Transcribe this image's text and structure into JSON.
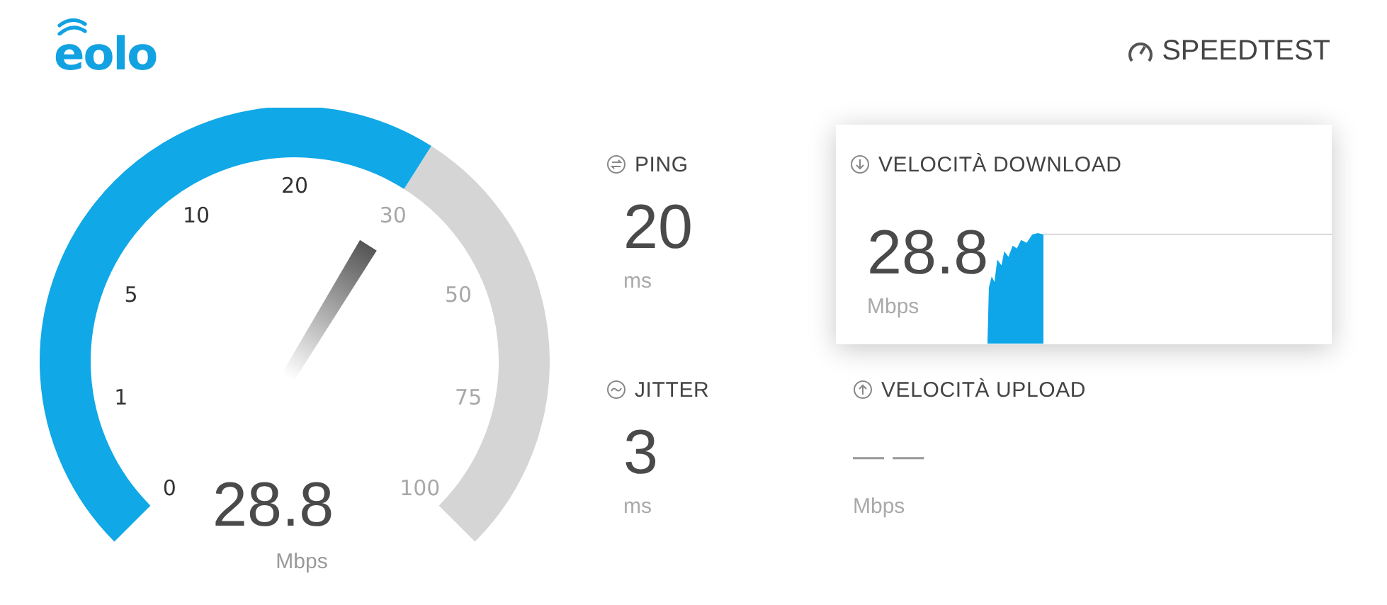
{
  "header": {
    "logo": "eolo",
    "brand": "SPEEDTEST"
  },
  "gauge": {
    "reading": "28.8",
    "unit": "Mbps",
    "ticks": [
      {
        "label": "0",
        "reached": true
      },
      {
        "label": "1",
        "reached": true
      },
      {
        "label": "5",
        "reached": true
      },
      {
        "label": "10",
        "reached": true
      },
      {
        "label": "20",
        "reached": true
      },
      {
        "label": "30",
        "reached": false
      },
      {
        "label": "50",
        "reached": false
      },
      {
        "label": "75",
        "reached": false
      },
      {
        "label": "100",
        "reached": false
      }
    ]
  },
  "metrics": [
    {
      "kind": "ping",
      "label": "PING",
      "value": "20",
      "unit": "ms",
      "highlighted": false,
      "measured": true
    },
    {
      "kind": "download",
      "label": "VELOCITÀ DOWNLOAD",
      "value": "28.8",
      "unit": "Mbps",
      "highlighted": true,
      "measured": true
    },
    {
      "kind": "jitter",
      "label": "JITTER",
      "value": "3",
      "unit": "ms",
      "highlighted": false,
      "measured": true
    },
    {
      "kind": "upload",
      "label": "VELOCITÀ UPLOAD",
      "value": "— —",
      "unit": "Mbps",
      "highlighted": false,
      "measured": false
    }
  ]
}
